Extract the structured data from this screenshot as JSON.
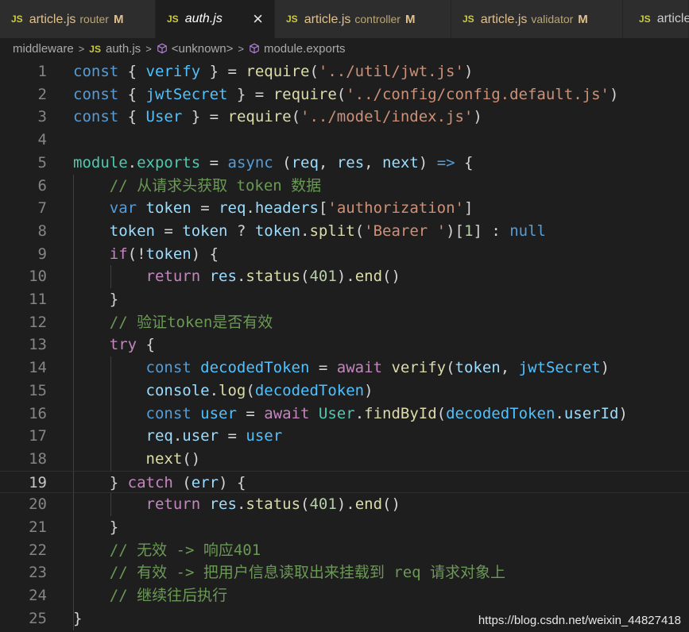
{
  "tabs": [
    {
      "icon": "JS",
      "name": "article.js",
      "desc": "router",
      "mod": "M"
    },
    {
      "icon": "JS",
      "name": "auth.js",
      "desc": "",
      "mod": "",
      "active": true,
      "close": "×"
    },
    {
      "icon": "JS",
      "name": "article.js",
      "desc": "controller",
      "mod": "M"
    },
    {
      "icon": "JS",
      "name": "article.js",
      "desc": "validator",
      "mod": "M"
    },
    {
      "icon": "JS",
      "name": "article.js",
      "desc": "",
      "mod": ""
    }
  ],
  "breadcrumb": {
    "folder": "middleware",
    "file_icon": "JS",
    "file": "auth.js",
    "symbol1": "<unknown>",
    "symbol2": "module.exports",
    "separator": ">"
  },
  "editor": {
    "current_line": 19,
    "lines": [
      {
        "n": "1",
        "tokens": [
          [
            "k",
            "const"
          ],
          [
            "p",
            " { "
          ],
          [
            "cst",
            "verify"
          ],
          [
            "p",
            " } = "
          ],
          [
            "f",
            "require"
          ],
          [
            "p",
            "("
          ],
          [
            "s",
            "'../util/jwt.js'"
          ],
          [
            "p",
            ")"
          ]
        ]
      },
      {
        "n": "2",
        "tokens": [
          [
            "k",
            "const"
          ],
          [
            "p",
            " { "
          ],
          [
            "cst",
            "jwtSecret"
          ],
          [
            "p",
            " } = "
          ],
          [
            "f",
            "require"
          ],
          [
            "p",
            "("
          ],
          [
            "s",
            "'../config/config.default.js'"
          ],
          [
            "p",
            ")"
          ]
        ]
      },
      {
        "n": "3",
        "tokens": [
          [
            "k",
            "const"
          ],
          [
            "p",
            " { "
          ],
          [
            "cst",
            "User"
          ],
          [
            "p",
            " } = "
          ],
          [
            "f",
            "require"
          ],
          [
            "p",
            "("
          ],
          [
            "s",
            "'../model/index.js'"
          ],
          [
            "p",
            ")"
          ]
        ]
      },
      {
        "n": "4",
        "tokens": []
      },
      {
        "n": "5",
        "tokens": [
          [
            "t",
            "module"
          ],
          [
            "p",
            "."
          ],
          [
            "t",
            "exports"
          ],
          [
            "p",
            " = "
          ],
          [
            "k",
            "async"
          ],
          [
            "p",
            " ("
          ],
          [
            "v",
            "req"
          ],
          [
            "p",
            ", "
          ],
          [
            "v",
            "res"
          ],
          [
            "p",
            ", "
          ],
          [
            "v",
            "next"
          ],
          [
            "p",
            ") "
          ],
          [
            "k",
            "=>"
          ],
          [
            "p",
            " {"
          ]
        ]
      },
      {
        "n": "6",
        "tokens": [
          [
            "p",
            "    "
          ],
          [
            "cm",
            "// 从请求头获取 token 数据"
          ]
        ]
      },
      {
        "n": "7",
        "tokens": [
          [
            "p",
            "    "
          ],
          [
            "k",
            "var"
          ],
          [
            "p",
            " "
          ],
          [
            "v",
            "token"
          ],
          [
            "p",
            " = "
          ],
          [
            "v",
            "req"
          ],
          [
            "p",
            "."
          ],
          [
            "v",
            "headers"
          ],
          [
            "p",
            "["
          ],
          [
            "s",
            "'authorization'"
          ],
          [
            "p",
            "]"
          ]
        ]
      },
      {
        "n": "8",
        "tokens": [
          [
            "p",
            "    "
          ],
          [
            "v",
            "token"
          ],
          [
            "p",
            " = "
          ],
          [
            "v",
            "token"
          ],
          [
            "p",
            " ? "
          ],
          [
            "v",
            "token"
          ],
          [
            "p",
            "."
          ],
          [
            "f",
            "split"
          ],
          [
            "p",
            "("
          ],
          [
            "s",
            "'Bearer '"
          ],
          [
            "p",
            ")["
          ],
          [
            "n",
            "1"
          ],
          [
            "p",
            "] : "
          ],
          [
            "k",
            "null"
          ]
        ]
      },
      {
        "n": "9",
        "tokens": [
          [
            "p",
            "    "
          ],
          [
            "c",
            "if"
          ],
          [
            "p",
            "(!"
          ],
          [
            "v",
            "token"
          ],
          [
            "p",
            ") {"
          ]
        ]
      },
      {
        "n": "10",
        "tokens": [
          [
            "p",
            "        "
          ],
          [
            "c",
            "return"
          ],
          [
            "p",
            " "
          ],
          [
            "v",
            "res"
          ],
          [
            "p",
            "."
          ],
          [
            "f",
            "status"
          ],
          [
            "p",
            "("
          ],
          [
            "n",
            "401"
          ],
          [
            "p",
            ")."
          ],
          [
            "f",
            "end"
          ],
          [
            "p",
            "()"
          ]
        ]
      },
      {
        "n": "11",
        "tokens": [
          [
            "p",
            "    }"
          ]
        ]
      },
      {
        "n": "12",
        "tokens": [
          [
            "p",
            "    "
          ],
          [
            "cm",
            "// 验证token是否有效"
          ]
        ]
      },
      {
        "n": "13",
        "tokens": [
          [
            "p",
            "    "
          ],
          [
            "c",
            "try"
          ],
          [
            "p",
            " {"
          ]
        ]
      },
      {
        "n": "14",
        "tokens": [
          [
            "p",
            "        "
          ],
          [
            "k",
            "const"
          ],
          [
            "p",
            " "
          ],
          [
            "cst",
            "decodedToken"
          ],
          [
            "p",
            " = "
          ],
          [
            "c",
            "await"
          ],
          [
            "p",
            " "
          ],
          [
            "f",
            "verify"
          ],
          [
            "p",
            "("
          ],
          [
            "v",
            "token"
          ],
          [
            "p",
            ", "
          ],
          [
            "cst",
            "jwtSecret"
          ],
          [
            "p",
            ")"
          ]
        ]
      },
      {
        "n": "15",
        "tokens": [
          [
            "p",
            "        "
          ],
          [
            "v",
            "console"
          ],
          [
            "p",
            "."
          ],
          [
            "f",
            "log"
          ],
          [
            "p",
            "("
          ],
          [
            "cst",
            "decodedToken"
          ],
          [
            "p",
            ")"
          ]
        ]
      },
      {
        "n": "16",
        "tokens": [
          [
            "p",
            "        "
          ],
          [
            "k",
            "const"
          ],
          [
            "p",
            " "
          ],
          [
            "cst",
            "user"
          ],
          [
            "p",
            " = "
          ],
          [
            "c",
            "await"
          ],
          [
            "p",
            " "
          ],
          [
            "t",
            "User"
          ],
          [
            "p",
            "."
          ],
          [
            "f",
            "findById"
          ],
          [
            "p",
            "("
          ],
          [
            "cst",
            "decodedToken"
          ],
          [
            "p",
            "."
          ],
          [
            "v",
            "userId"
          ],
          [
            "p",
            ")"
          ]
        ]
      },
      {
        "n": "17",
        "tokens": [
          [
            "p",
            "        "
          ],
          [
            "v",
            "req"
          ],
          [
            "p",
            "."
          ],
          [
            "v",
            "user"
          ],
          [
            "p",
            " = "
          ],
          [
            "cst",
            "user"
          ]
        ]
      },
      {
        "n": "18",
        "tokens": [
          [
            "p",
            "        "
          ],
          [
            "f",
            "next"
          ],
          [
            "p",
            "()"
          ]
        ]
      },
      {
        "n": "19",
        "tokens": [
          [
            "p",
            "    } "
          ],
          [
            "c",
            "catch"
          ],
          [
            "p",
            " ("
          ],
          [
            "v",
            "err"
          ],
          [
            "p",
            ") {"
          ]
        ]
      },
      {
        "n": "20",
        "tokens": [
          [
            "p",
            "        "
          ],
          [
            "c",
            "return"
          ],
          [
            "p",
            " "
          ],
          [
            "v",
            "res"
          ],
          [
            "p",
            "."
          ],
          [
            "f",
            "status"
          ],
          [
            "p",
            "("
          ],
          [
            "n",
            "401"
          ],
          [
            "p",
            ")."
          ],
          [
            "f",
            "end"
          ],
          [
            "p",
            "()"
          ]
        ]
      },
      {
        "n": "21",
        "tokens": [
          [
            "p",
            "    }"
          ]
        ]
      },
      {
        "n": "22",
        "tokens": [
          [
            "p",
            "    "
          ],
          [
            "cm",
            "// 无效 -> 响应401"
          ]
        ]
      },
      {
        "n": "23",
        "tokens": [
          [
            "p",
            "    "
          ],
          [
            "cm",
            "// 有效 -> 把用户信息读取出来挂载到 req 请求对象上"
          ]
        ]
      },
      {
        "n": "24",
        "tokens": [
          [
            "p",
            "    "
          ],
          [
            "cm",
            "// 继续往后执行"
          ]
        ]
      },
      {
        "n": "25",
        "tokens": [
          [
            "p",
            "}"
          ]
        ]
      }
    ]
  },
  "watermark": "https://blog.csdn.net/weixin_44827418",
  "colors": {
    "keyword": "#569cd6",
    "control": "#c586c0",
    "variable": "#9cdcfe",
    "constant": "#4fc1ff",
    "string": "#ce9178",
    "function": "#dcdcaa",
    "type": "#4ec9b0",
    "number": "#b5cea8",
    "comment": "#6a9955",
    "js_icon": "#cbcb41",
    "modified": "#e2c08d"
  }
}
